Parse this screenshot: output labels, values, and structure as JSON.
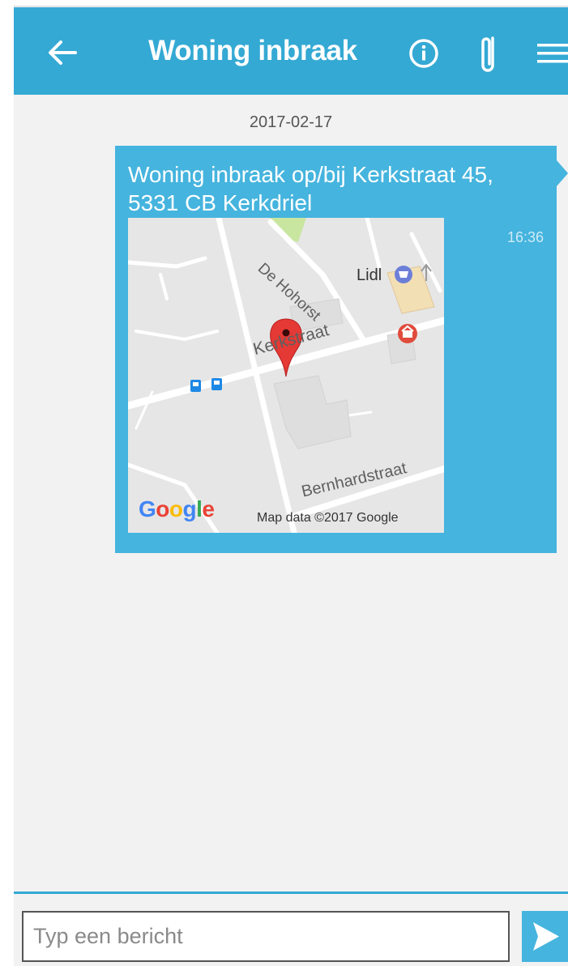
{
  "header": {
    "title": "Woning inbraak",
    "back_icon": "arrow-left-icon",
    "info_icon": "info-circle-icon",
    "attach_icon": "paperclip-icon",
    "menu_icon": "hamburger-menu-icon"
  },
  "chat": {
    "date": "2017-02-17",
    "messages": [
      {
        "text": "Woning inbraak op/bij Kerkstraat 45, 5331 CB Kerkdriel",
        "time": "16:36",
        "map": {
          "labels": {
            "street_1": "De Hohorst",
            "poi": "Lidl",
            "street_2": "Kerkstraat",
            "street_3": "Bernhardstraat",
            "logo": "Google",
            "attribution": "Map data ©2017 Google"
          }
        }
      }
    ]
  },
  "composer": {
    "placeholder": "Typ een bericht",
    "send_icon": "send-arrow-icon"
  },
  "colors": {
    "header": "#34a9d4",
    "bubble": "#45b4de",
    "background": "#f2f2f2",
    "pin": "#e53935"
  }
}
